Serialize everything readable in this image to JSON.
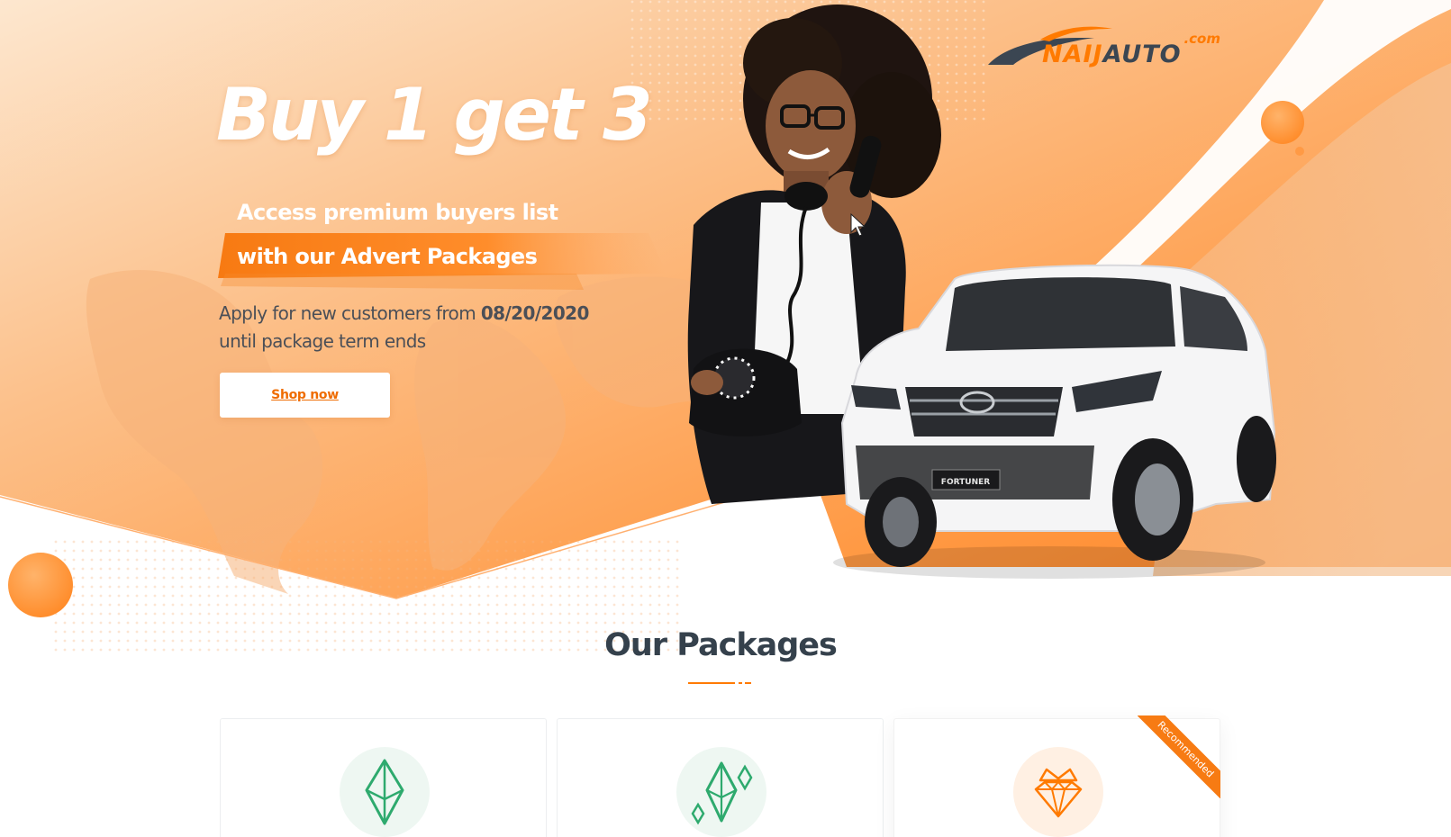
{
  "brand": {
    "name_part1": "NAIJ",
    "name_part2": "AUTO",
    "tld": ".com",
    "accent_color": "#ff7a00",
    "dark_color": "#3b4652"
  },
  "hero": {
    "headline": "Buy 1 get 3",
    "subtitle_line1": "Access premium buyers list",
    "subtitle_line2": "with our Advert Packages",
    "apply_prefix": "Apply for new customers from ",
    "apply_date": "08/20/2020",
    "apply_suffix": "until package term ends",
    "cta_label": "Shop now",
    "image_alt_person": "woman-on-phone",
    "image_alt_car": "white-suv",
    "car_badge": "FORTUNER"
  },
  "packages": {
    "title": "Our Packages",
    "cards": [
      {
        "icon": "gem-icon",
        "tint": "#2eaa6e"
      },
      {
        "icon": "gems-icon",
        "tint": "#2eaa6e"
      },
      {
        "icon": "crown-diamond-icon",
        "tint": "#ff7a00",
        "badge": "Recommended"
      }
    ]
  },
  "colors": {
    "hero_orange": "#ff8a2a",
    "hero_light": "#fde3c8",
    "text_dark": "#35414c"
  }
}
